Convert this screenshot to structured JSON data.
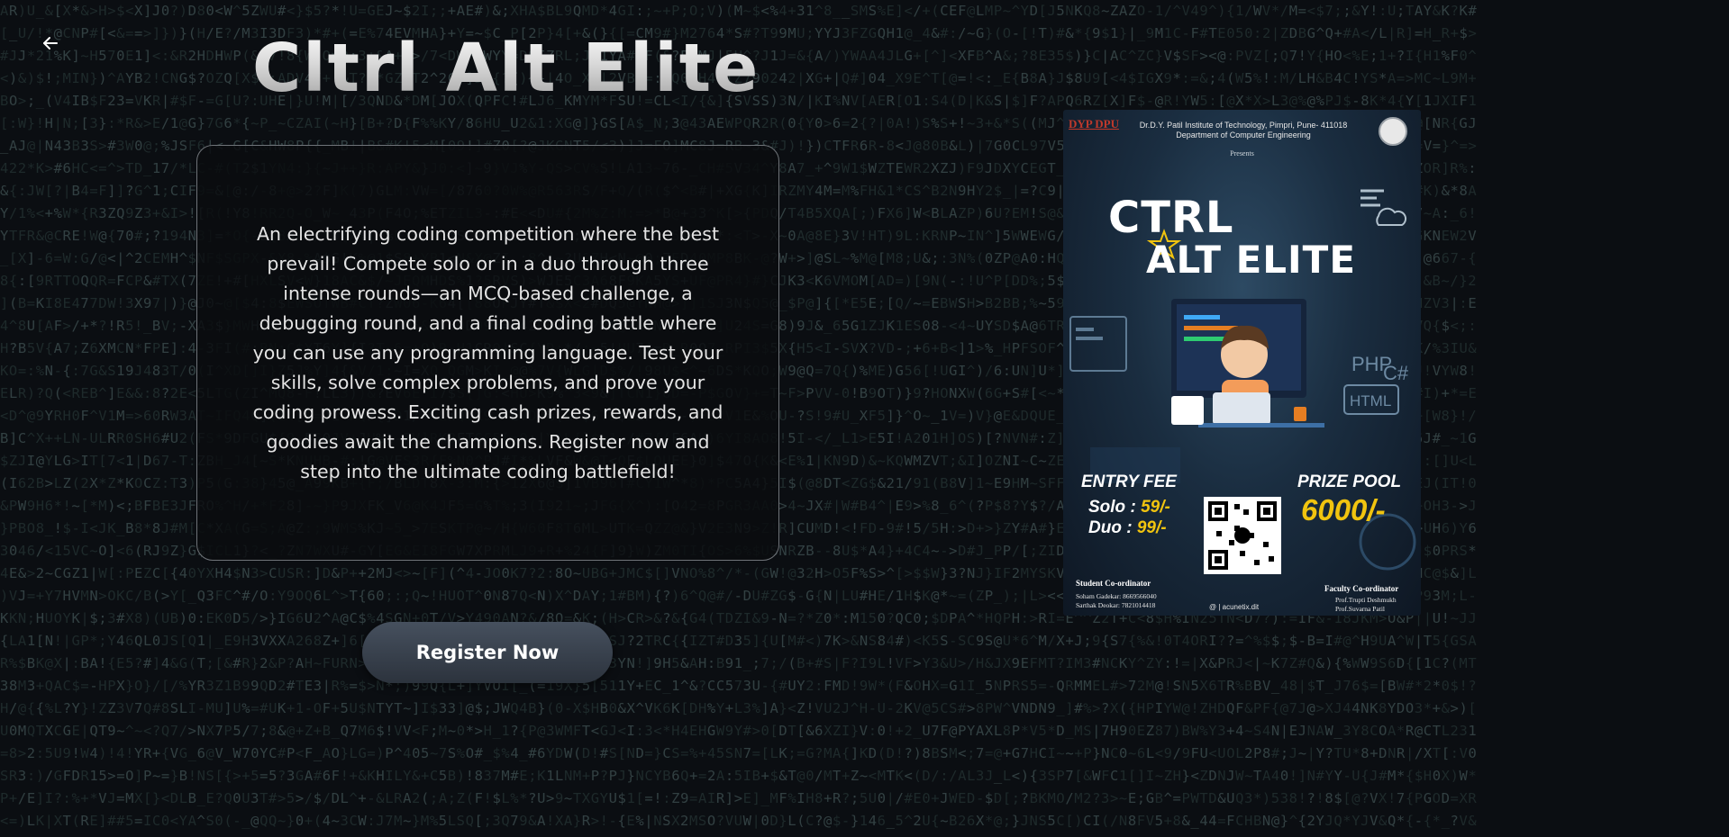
{
  "page": {
    "title": "Cltrl Alt Elite",
    "description": "An electrifying coding competition where the best prevail! Compete solo or in a duo through three intense rounds—an MCQ-based challenge, a debugging round, and a final coding battle where you can use any programming language. Test your skills, solve complex problems, and prove your coding prowess. Exciting cash prizes, rewards, and goodies await the champions. Register now and step into the ultimate coding battlefield!",
    "register_label": "Register Now"
  },
  "icons": {
    "back": "arrow-left-icon"
  },
  "colors": {
    "background": "#0b0e12",
    "matrix_text": "#1e2a2b",
    "card_border": "#6f7378",
    "button_bg": "#3a424d",
    "poster_accent": "#f1c40f"
  },
  "poster": {
    "logo_text": "DYP DPU",
    "institute": "Dr.D.Y. Patil Institute of Technology, Pimpri, Pune- 411018",
    "department": "Department of Computer Engineering",
    "presents": "Presents",
    "title_line1": "CTRL",
    "title_line2": "ALT ELITE",
    "entry_fee_heading": "ENTRY FEE",
    "solo_label": "Solo : ",
    "solo_value": "59/-",
    "duo_label": "Duo : ",
    "duo_value": "99/-",
    "prize_pool_heading": "PRIZE POOL",
    "prize_pool_value": "6000/-",
    "student_coord_heading": "Student Co-ordinator",
    "student_coord_1": "Soham Gadekar: 8669566040",
    "student_coord_2": "Sarthak Deokar: 7821014418",
    "faculty_coord_heading": "Faculty Co-ordinator",
    "faculty_coord_1": "Prof.Trupti Deshmukh",
    "faculty_coord_2": "Prof.Suvarna Patil",
    "social_handle": "@ | acunetix.dit"
  }
}
